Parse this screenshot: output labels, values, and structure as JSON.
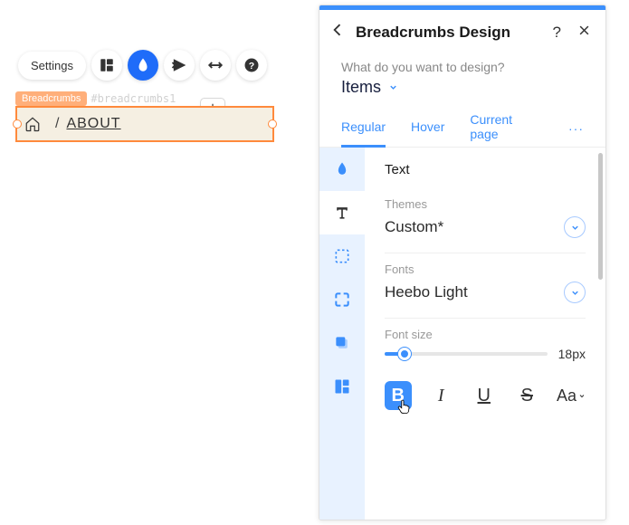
{
  "toolbar": {
    "settings": "Settings"
  },
  "tag": {
    "label": "Breadcrumbs",
    "id": "#breadcrumbs1"
  },
  "breadcrumb": {
    "separator": "/",
    "current": "ABOUT"
  },
  "panel": {
    "title": "Breadcrumbs Design",
    "question": "What do you want to design?",
    "target": "Items",
    "state_tabs": {
      "regular": "Regular",
      "hover": "Hover",
      "current": "Current page",
      "more": "···"
    },
    "text": {
      "section": "Text",
      "themes_label": "Themes",
      "themes_value": "Custom*",
      "fonts_label": "Fonts",
      "fonts_value": "Heebo Light",
      "fontsize_label": "Font size",
      "fontsize_value": "18px",
      "format": {
        "bold": "B",
        "italic": "I",
        "underline": "U",
        "strike": "S",
        "case": "Aa"
      }
    }
  }
}
